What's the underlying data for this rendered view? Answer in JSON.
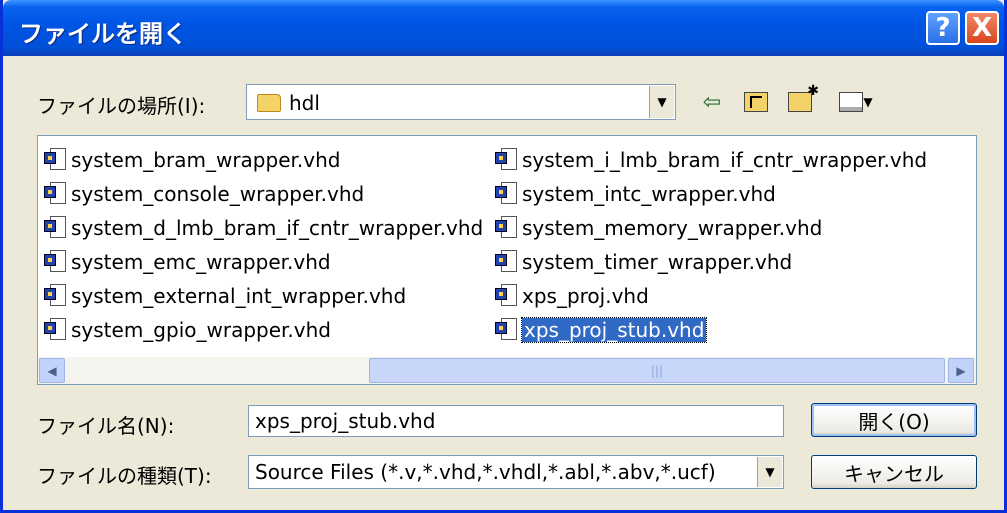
{
  "window": {
    "title": "ファイルを開く",
    "help_label": "?",
    "close_label": "X"
  },
  "location": {
    "label": "ファイルの場所(I):",
    "folder": "hdl"
  },
  "files": [
    "system_bram_wrapper.vhd",
    "system_console_wrapper.vhd",
    "system_d_lmb_bram_if_cntr_wrapper.vhd",
    "system_emc_wrapper.vhd",
    "system_external_int_wrapper.vhd",
    "system_gpio_wrapper.vhd",
    "system_i_lmb_bram_if_cntr_wrapper.vhd",
    "system_intc_wrapper.vhd",
    "system_memory_wrapper.vhd",
    "system_timer_wrapper.vhd",
    "xps_proj.vhd",
    "xps_proj_stub.vhd"
  ],
  "selected_file": "xps_proj_stub.vhd",
  "filename": {
    "label": "ファイル名(N):",
    "value": "xps_proj_stub.vhd"
  },
  "filetype": {
    "label": "ファイルの種類(T):",
    "value": "Source Files (*.v,*.vhd,*.vhdl,*.abl,*.abv,*.ucf)"
  },
  "buttons": {
    "open": "開く(O)",
    "cancel": "キャンセル"
  },
  "icons": {
    "back": "left-arrow-icon",
    "up": "folder-up-icon",
    "new_folder": "new-folder-icon",
    "view_menu": "view-menu-icon"
  }
}
